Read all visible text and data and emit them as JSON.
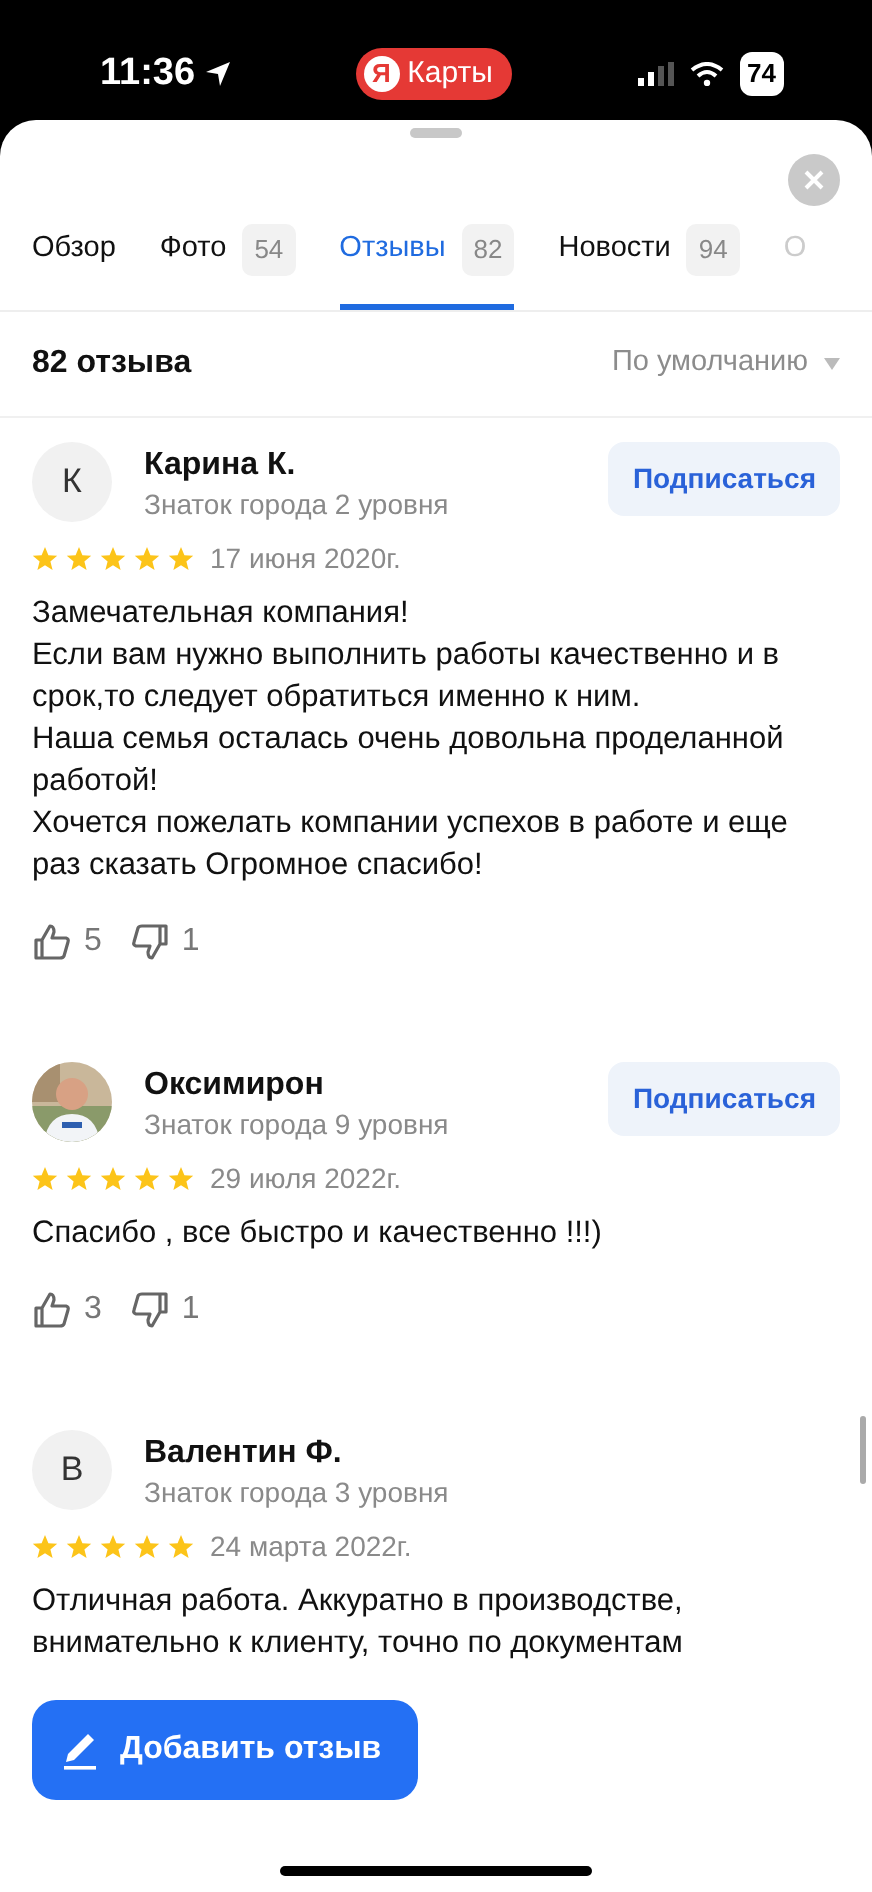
{
  "status_bar": {
    "time": "11:36",
    "app_pill": {
      "logo": "Я",
      "label": "Карты"
    },
    "battery": "74"
  },
  "tabs": [
    {
      "label": "Обзор",
      "selected": false
    },
    {
      "label": "Фото",
      "count": "54",
      "selected": false
    },
    {
      "label": "Отзывы",
      "count": "82",
      "selected": true
    },
    {
      "label": "Новости",
      "count": "94",
      "selected": false
    },
    {
      "label": "О",
      "selected": false
    }
  ],
  "summary": {
    "count_label": "82 отзыва",
    "sort": "По умолчанию"
  },
  "reviews": [
    {
      "avatar": {
        "kind": "initial",
        "letter": "К"
      },
      "name": "Карина К.",
      "level": "Знаток города 2 уровня",
      "subscribe": "Подписаться",
      "stars": 5,
      "date": "17 июня 2020г.",
      "text": "Замечательная компания!\nЕсли вам нужно выполнить работы качественно и в срок,то следует обратиться именно к ним.\nНаша семья осталась очень довольна проделанной работой!\nХочется пожелать компании успехов в работе и еще раз сказать Огромное спасибо!",
      "likes": "5",
      "dislikes": "1"
    },
    {
      "name": "Оксимирон",
      "level": "Знаток города 9 уровня",
      "subscribe": "Подписаться",
      "stars": 5,
      "date": "29 июля 2022г.",
      "text": "Спасибо , все быстро и качественно !!!)",
      "likes": "3",
      "dislikes": "1"
    },
    {
      "avatar": {
        "kind": "initial",
        "letter": "В"
      },
      "name": "Валентин Ф.",
      "level": "Знаток города 3 уровня",
      "stars": 5,
      "date": "24 марта 2022г.",
      "text": "Отличная работа. Аккуратно в производстве, внимательно к клиенту, точно по документам"
    }
  ],
  "add_review_button": "Добавить отзыв"
}
